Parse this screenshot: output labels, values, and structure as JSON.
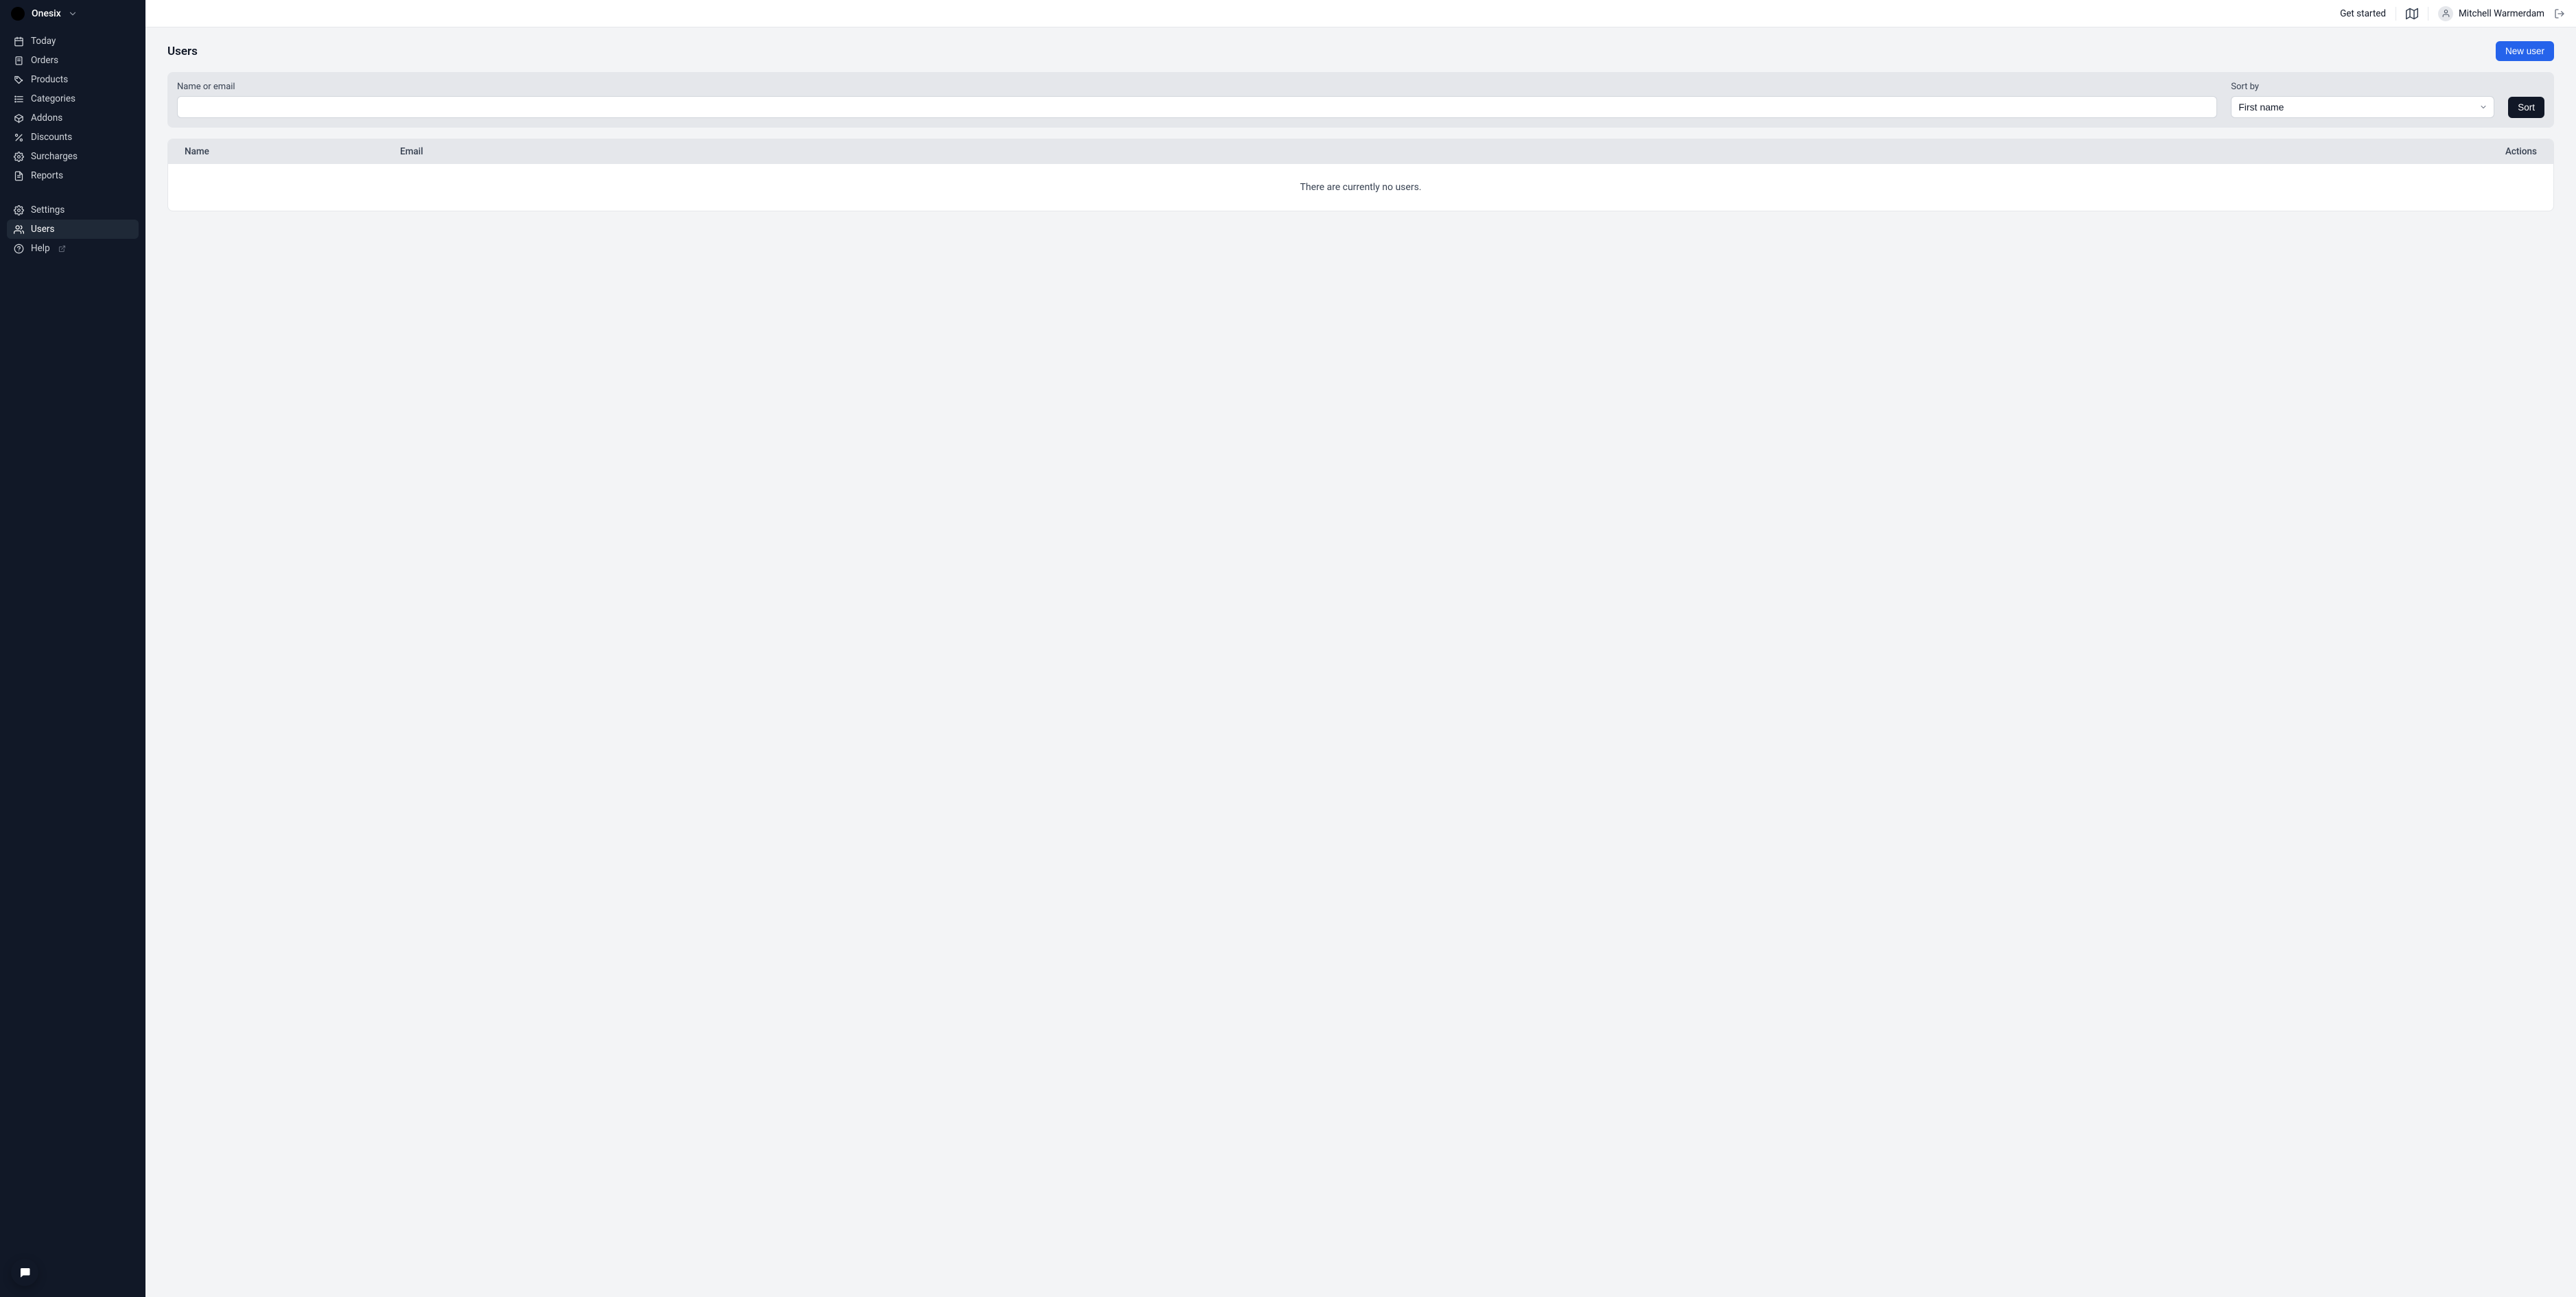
{
  "org": {
    "name": "Onesix"
  },
  "sidebar": {
    "primary": [
      {
        "id": "today",
        "label": "Today"
      },
      {
        "id": "orders",
        "label": "Orders"
      },
      {
        "id": "products",
        "label": "Products"
      },
      {
        "id": "categories",
        "label": "Categories"
      },
      {
        "id": "addons",
        "label": "Addons"
      },
      {
        "id": "discounts",
        "label": "Discounts"
      },
      {
        "id": "surcharges",
        "label": "Surcharges"
      },
      {
        "id": "reports",
        "label": "Reports"
      }
    ],
    "secondary": [
      {
        "id": "settings",
        "label": "Settings"
      },
      {
        "id": "users",
        "label": "Users",
        "active": true
      },
      {
        "id": "help",
        "label": "Help",
        "external": true
      }
    ]
  },
  "topbar": {
    "get_started": "Get started",
    "user_name": "Mitchell Warmerdam"
  },
  "page": {
    "title": "Users",
    "new_user_button": "New user"
  },
  "filters": {
    "name_or_email_label": "Name or email",
    "name_or_email_value": "",
    "sort_by_label": "Sort by",
    "sort_by_selected": "First name",
    "sort_button": "Sort"
  },
  "table": {
    "columns": {
      "name": "Name",
      "email": "Email",
      "actions": "Actions"
    },
    "empty_message": "There are currently no users."
  }
}
